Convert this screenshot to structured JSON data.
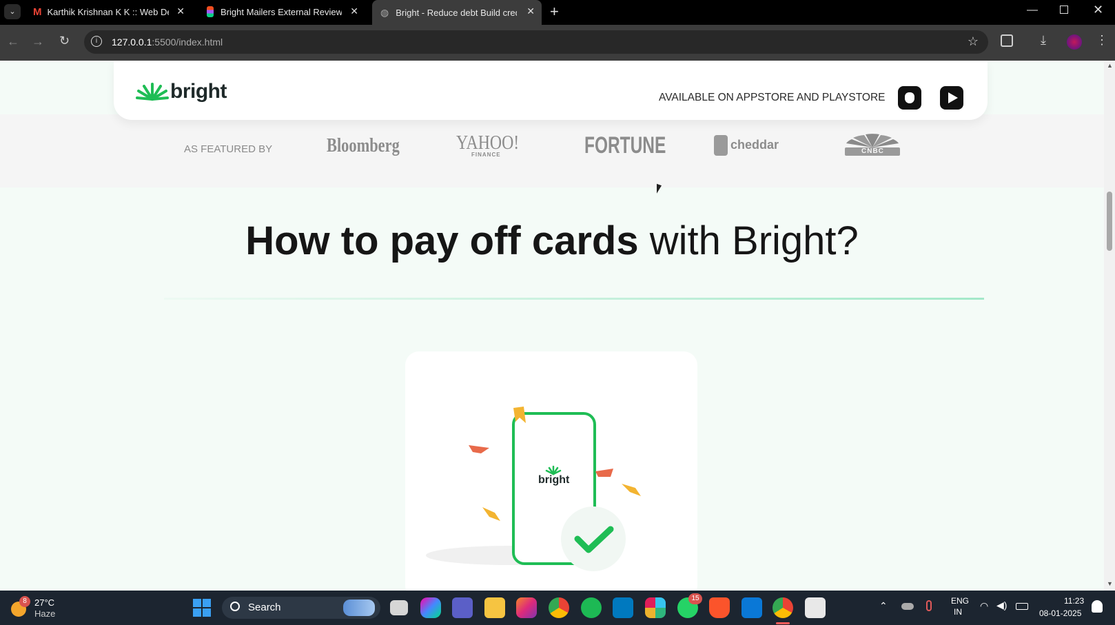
{
  "browser": {
    "tabs": [
      {
        "title": "Karthik Krishnan K K :: Web Dev",
        "icon": "gmail-icon"
      },
      {
        "title": "Bright Mailers External Review -",
        "icon": "figma-icon"
      },
      {
        "title": "Bright - Reduce debt Build cred",
        "icon": "globe-icon"
      }
    ],
    "url_host": "127.0.0.1",
    "url_path": ":5500/index.html"
  },
  "page": {
    "brand": "bright",
    "availability": "AVAILABLE ON APPSTORE AND PLAYSTORE",
    "featured_label": "AS FEATURED BY",
    "featured_logos": [
      "Bloomberg",
      "YAHOO!",
      "FORTUNE",
      "cheddar",
      "CNBC"
    ],
    "yahoo_sub": "FINANCE",
    "headline_bold": "How to pay off cards",
    "headline_light": "with Bright?",
    "phone_brand": "bright",
    "accent_color": "#1fbd55"
  },
  "taskbar": {
    "weather_temp": "27°C",
    "weather_desc": "Haze",
    "weather_badge": "8",
    "search_label": "Search",
    "whatsapp_badge": "15",
    "lang_line1": "ENG",
    "lang_line2": "IN",
    "time": "11:23",
    "date": "08-01-2025"
  }
}
